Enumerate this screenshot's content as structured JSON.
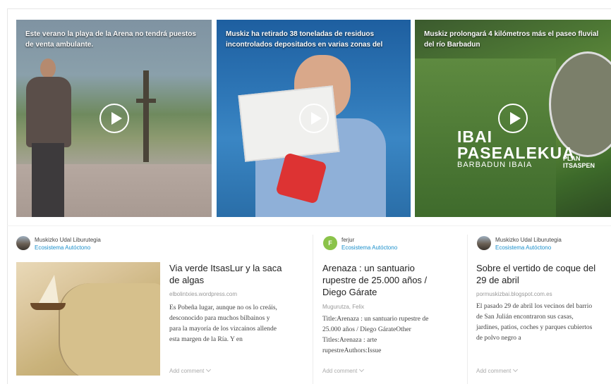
{
  "videos": [
    {
      "title": "Este verano la playa de la Arena no tendrá puestos de venta ambulante."
    },
    {
      "title": "Muskiz ha retirado 38 toneladas de residuos incontrolados depositados en varias zonas del"
    },
    {
      "title": "Muskiz prolongará 4 kilómetros más el paseo fluvial del río Barbadun"
    }
  ],
  "video3_board": {
    "line1": "IBAI",
    "line2": "PASEALEKUA",
    "line3": "BARBADUN IBAIA",
    "plan": "PLAN ITSASPEN"
  },
  "cards": [
    {
      "source_name": "Muskizko Udal Liburutegia",
      "category": "Ecosistema Autóctono",
      "title": "Via verde ItsasLur y la saca de algas",
      "domain": "elbolintxies.wordpress.com",
      "body": "Es Pobeña lugar, aunque no os lo creáis, desconocido para muchos bilbainos y para la mayoría de los vizcainos allende esta margen de la Ría. Y en",
      "comment": "Add comment"
    },
    {
      "source_name": "ferjur",
      "avatar_letter": "F",
      "category": "Ecosistema Autóctono",
      "title": "Arenaza : un santuario rupestre de 25.000 años / Diego Gárate",
      "domain": "Mugurutza, Felix",
      "body": "Title:Arenaza : un santuario rupestre de 25.000 años / Diego GárateOther Titles:Arenaza : arte rupestreAuthors:Issue",
      "comment": "Add comment"
    },
    {
      "source_name": "Muskizko Udal Liburutegia",
      "category": "Ecosistema Autóctono",
      "title": "Sobre el vertido de coque del 29 de abril",
      "domain": "pormuskizbai.blogspot.com.es",
      "body": "El pasado 29 de abril los vecinos del barrio de San Julián encontraron sus casas, jardines, patios, coches y parques cubiertos de polvo negro a",
      "comment": "Add comment"
    }
  ],
  "colors": {
    "category": "#1a8fcb",
    "avatar_green": "#8bc34a"
  }
}
